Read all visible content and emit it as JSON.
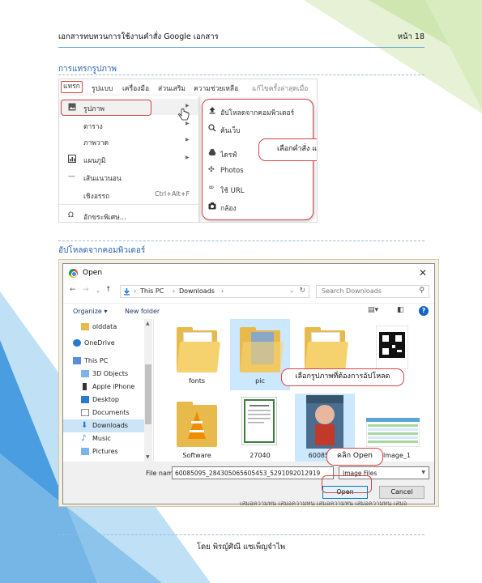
{
  "header": {
    "title": "เอกสารทบทวนการใช้งานคำสั่ง Google เอกสาร",
    "page": "หน้า 18"
  },
  "section1": {
    "title": "การแทรกรูปภาพ",
    "menubar": [
      "แทรก",
      "รูปแบบ",
      "เครื่องมือ",
      "ส่วนเสริม",
      "ความช่วยเหลือ",
      "แก้ไขครั้งล่าสุดเมื่อ"
    ],
    "insert_menu": [
      {
        "label": "รูปภาพ",
        "icon": "image-icon",
        "arrow": true
      },
      {
        "label": "ตาราง",
        "icon": "",
        "arrow": true
      },
      {
        "label": "ภาพวาด",
        "icon": "",
        "arrow": true
      },
      {
        "label": "แผนภูมิ",
        "icon": "chart-icon",
        "arrow": true
      },
      {
        "label": "เส้นแนวนอน",
        "icon": "horizontal-line-icon",
        "arrow": false
      },
      {
        "label": "เชิงอรรถ",
        "icon": "",
        "shortcut": "Ctrl+Alt+F"
      },
      {
        "label": "อักขระพิเศษ...",
        "icon": "omega-icon",
        "arrow": false
      }
    ],
    "image_submenu": [
      {
        "label": "อัปโหลดจากคอมพิวเตอร์",
        "icon": "upload-icon"
      },
      {
        "label": "ค้นเว็บ",
        "icon": "search-icon"
      },
      {
        "label": "ไดรฟ์",
        "icon": "drive-icon"
      },
      {
        "label": "Photos",
        "icon": "photos-icon"
      },
      {
        "label": "ใช้ URL",
        "icon": "link-icon"
      },
      {
        "label": "กล้อง",
        "icon": "camera-icon"
      }
    ],
    "callout": "เลือกคำสั่ง แทรก > รูปภาพ"
  },
  "section2": {
    "title": "อัปโหลดจากคอมพิวเตอร์",
    "dialog": {
      "title": "Open",
      "path": [
        "This PC",
        "Downloads"
      ],
      "search_placeholder": "Search Downloads",
      "organize": "Organize ▾",
      "new_folder": "New folder",
      "nav_items": [
        {
          "label": "olddata",
          "icon": "folder-icon"
        },
        {
          "label": "OneDrive",
          "icon": "cloud-icon"
        },
        {
          "label": "This PC",
          "icon": "computer-icon"
        },
        {
          "label": "3D Objects",
          "icon": "cube-icon"
        },
        {
          "label": "Apple iPhone",
          "icon": "phone-icon"
        },
        {
          "label": "Desktop",
          "icon": "desktop-icon"
        },
        {
          "label": "Documents",
          "icon": "documents-icon"
        },
        {
          "label": "Downloads",
          "icon": "download-icon",
          "selected": true
        },
        {
          "label": "Music",
          "icon": "music-icon"
        },
        {
          "label": "Pictures",
          "icon": "pictures-icon"
        }
      ],
      "files": [
        {
          "label": "",
          "kind": "folder"
        },
        {
          "label": "fonts",
          "kind": "folder"
        },
        {
          "label": "pic",
          "kind": "folder-photo"
        },
        {
          "label": "er",
          "kind": "folder"
        },
        {
          "label": "",
          "kind": "qr"
        },
        {
          "label": "Software",
          "kind": "vlc"
        },
        {
          "label": "27040",
          "kind": "document"
        },
        {
          "label": "60085095",
          "kind": "photo"
        },
        {
          "label": "gelmage_1",
          "kind": "spreadsheet"
        }
      ],
      "file_name_label": "File name:",
      "file_name_value": "60085095_284305065605453_5291092012919",
      "file_type": "Image Files",
      "open_button": "Open",
      "cancel_button": "Cancel"
    },
    "callout_select": "เลือกรูปภาพที่ต้องการอัปโหลด",
    "callout_open": "คลิก Open"
  },
  "stray_text": "เสมอความทน เสมอความทน เสมอความทน เสมอความทน เสมอ",
  "footer": "โดย พิรญ์ศิณี แซเพ็ญจำไพ",
  "colors": {
    "accent_blue": "#2a63b0",
    "highlight_red": "#d64545",
    "triangle_green": "#cfe6b0",
    "triangle_blue": "#4a9de0"
  }
}
